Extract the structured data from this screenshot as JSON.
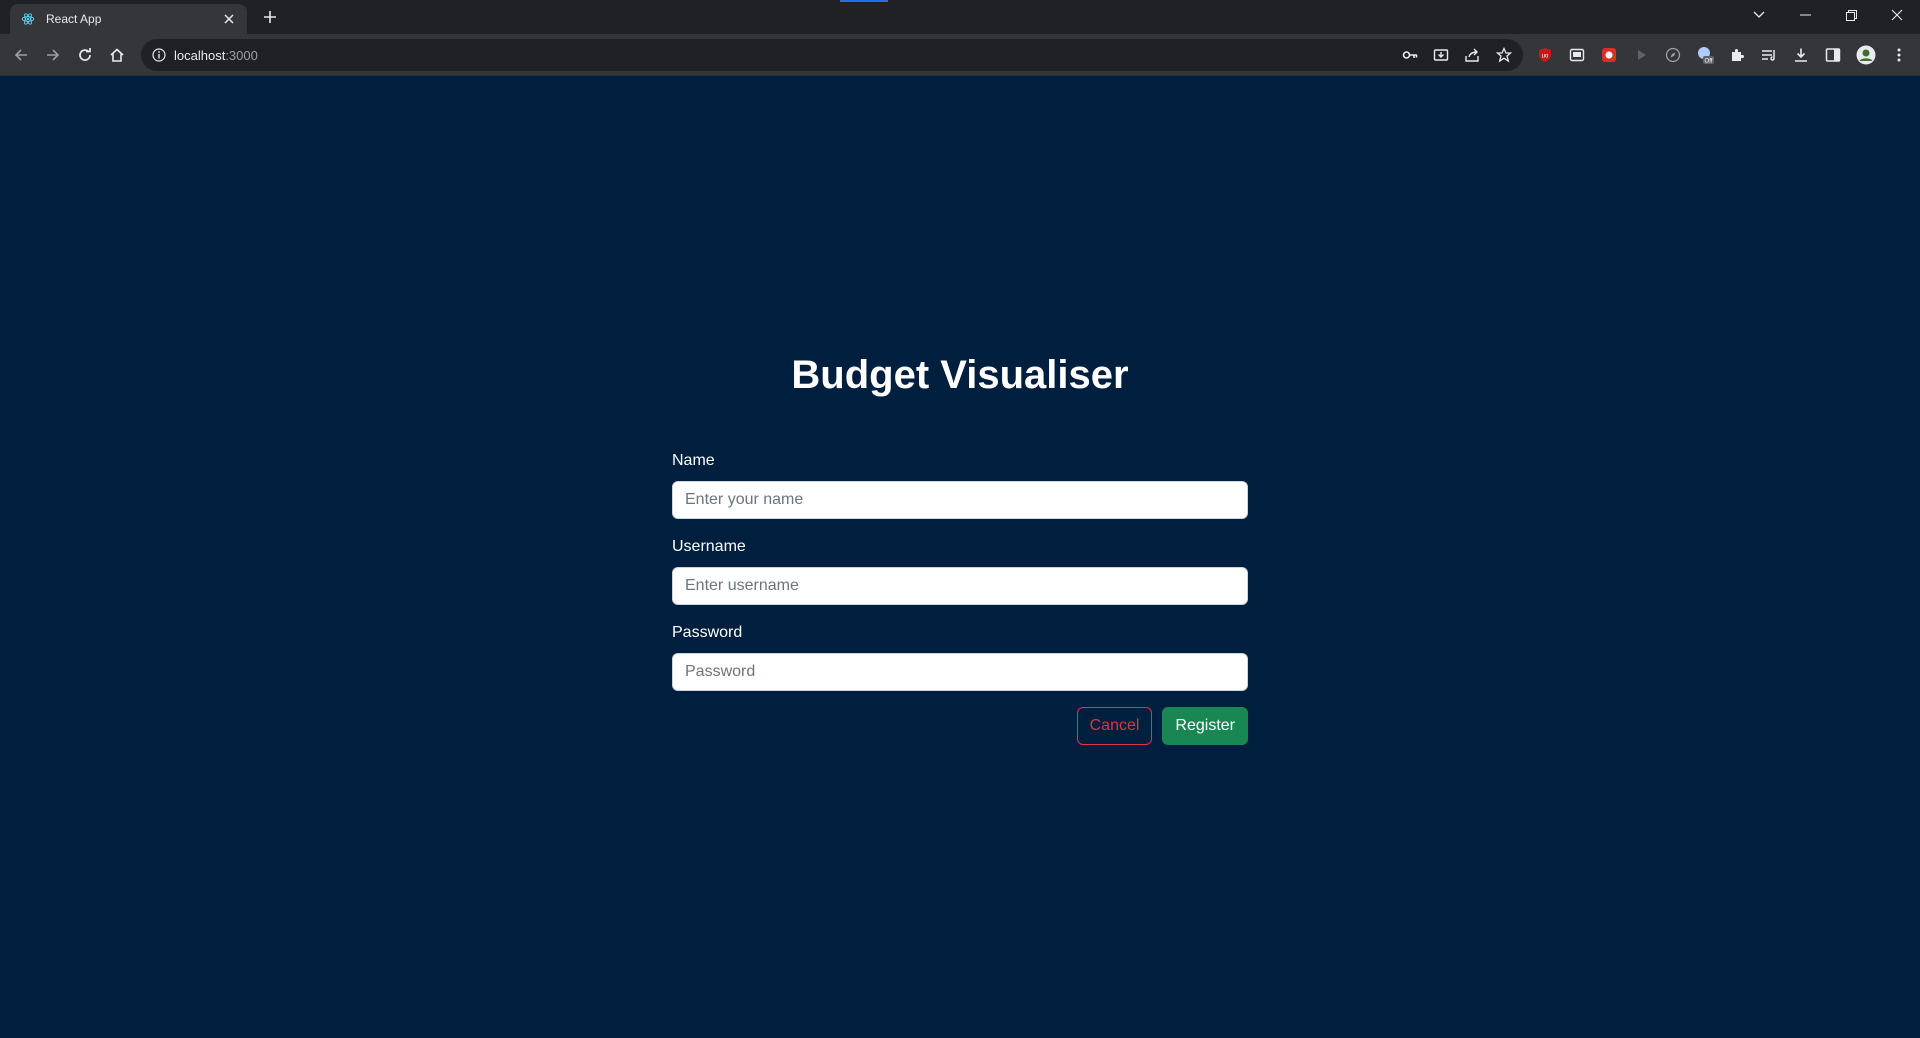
{
  "browser": {
    "tab_title": "React App",
    "url_host": "localhost",
    "url_port": ":3000"
  },
  "app": {
    "title": "Budget Visualiser",
    "form": {
      "name_label": "Name",
      "name_placeholder": "Enter your name",
      "username_label": "Username",
      "username_placeholder": "Enter username",
      "password_label": "Password",
      "password_placeholder": "Password",
      "cancel_label": "Cancel",
      "register_label": "Register"
    }
  },
  "colors": {
    "page_background": "#001e3e",
    "cancel": "#dc3545",
    "register": "#198754"
  },
  "icons": [
    "react-favicon-icon",
    "tab-close-icon",
    "new-tab-icon",
    "back-icon",
    "forward-icon",
    "reload-icon",
    "home-icon",
    "site-info-icon",
    "password-key-icon",
    "install-app-icon",
    "share-icon",
    "bookmark-star-icon",
    "extensions-icon",
    "reading-list-icon",
    "downloads-icon",
    "side-panel-icon",
    "profile-avatar-icon"
  ]
}
